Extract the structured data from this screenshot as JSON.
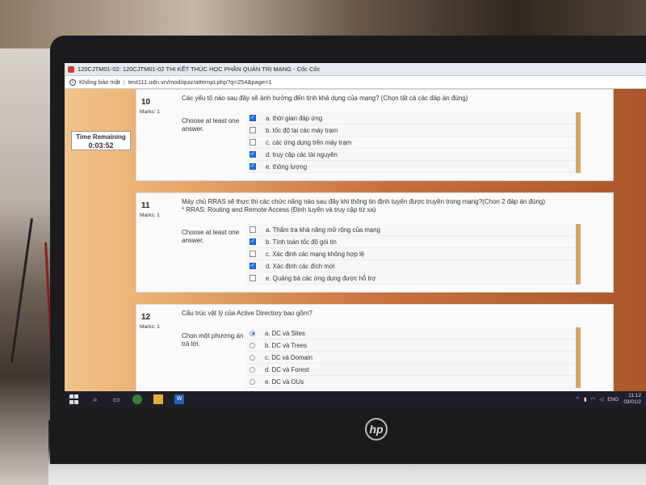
{
  "window": {
    "title": "120CJTM01-02: 120CJTM01-02 THI KẾT THÚC HỌC PHẦN QUẢN TRỊ MẠNG - Cốc Cốc"
  },
  "address": {
    "security": "Không bảo mật",
    "url": "test111.udn.vn/mod/quiz/attempt.php?q=254&page=1"
  },
  "timer": {
    "label": "Time Remaining",
    "value": "0:03:52"
  },
  "questions": [
    {
      "number": "10",
      "marks": "Marks: 1",
      "text": "Các yếu tố nào sau đây sẽ ảnh hưởng đến tính khả dụng của mạng? (Chọn tất cả các đáp án đúng)",
      "prompt": "Choose at least one answer.",
      "type": "checkbox",
      "answers": [
        {
          "label": "a. thời gian đáp ứng",
          "checked": true
        },
        {
          "label": "b. tốc độ tại các máy trạm",
          "checked": false
        },
        {
          "label": "c. các ứng dụng trên máy trạm",
          "checked": false
        },
        {
          "label": "d. truy cập các tài nguyên",
          "checked": true
        },
        {
          "label": "e. thông lượng",
          "checked": true
        }
      ]
    },
    {
      "number": "11",
      "marks": "Marks: 1",
      "text": "Máy chủ RRAS sẽ thực thi các chức năng nào sau đây khi thông tin định tuyến được truyền trong mạng?(Chọn 2 đáp án đúng)",
      "text2": "* RRAS: Routing and Remote Access (Định tuyến và truy cập từ xa)",
      "prompt": "Choose at least one answer.",
      "type": "checkbox",
      "answers": [
        {
          "label": "a. Thẩm tra khả năng mở rộng của mạng",
          "checked": false
        },
        {
          "label": "b. Tính toán tốc độ gói tin",
          "checked": true
        },
        {
          "label": "c. Xác định các mạng không hợp lệ",
          "checked": false
        },
        {
          "label": "d. Xác định các đích mới",
          "checked": true
        },
        {
          "label": "e. Quảng bá các ứng dụng được hỗ trợ",
          "checked": false
        }
      ]
    },
    {
      "number": "12",
      "marks": "Marks: 1",
      "text": "Cấu trúc vật lý của Active Directory bao gồm?",
      "prompt": "Chọn một phương án trả lời.",
      "type": "radio",
      "answers": [
        {
          "label": "a. DC và Sites",
          "checked": true
        },
        {
          "label": "b. DC và Trees",
          "checked": false
        },
        {
          "label": "c. DC và Domain",
          "checked": false
        },
        {
          "label": "d. DC và Forest",
          "checked": false
        },
        {
          "label": "e. DC và OUs",
          "checked": false
        }
      ]
    }
  ],
  "taskbar": {
    "language": "ENG",
    "time": "11:12",
    "date": "03/01/2"
  },
  "brand": {
    "logo": "hp"
  }
}
